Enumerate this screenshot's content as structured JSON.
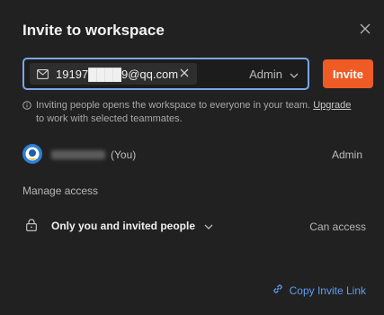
{
  "dialog": {
    "title": "Invite to workspace"
  },
  "invite": {
    "email_value": "19197████9@qq.com",
    "role_selected": "Admin",
    "invite_button": "Invite",
    "info_text_before_link": "Inviting people opens the workspace to everyone in your team.",
    "info_link": "Upgrade",
    "info_text_after_link": "to work with selected teammates."
  },
  "member": {
    "you_label": "(You)",
    "role": "Admin"
  },
  "access": {
    "section_title": "Manage access",
    "selected_option": "Only you and invited people",
    "permission": "Can access"
  },
  "footer": {
    "copy_link": "Copy Invite Link"
  },
  "colors": {
    "accent_invite": "#ef5b25",
    "focus_border": "#7aa6e8",
    "link": "#5e9cf0",
    "dialog_bg": "#212121"
  },
  "icons": [
    "close-icon",
    "mail-icon",
    "remove-chip-icon",
    "chevron-down-icon",
    "info-icon",
    "lock-icon",
    "link-icon"
  ]
}
